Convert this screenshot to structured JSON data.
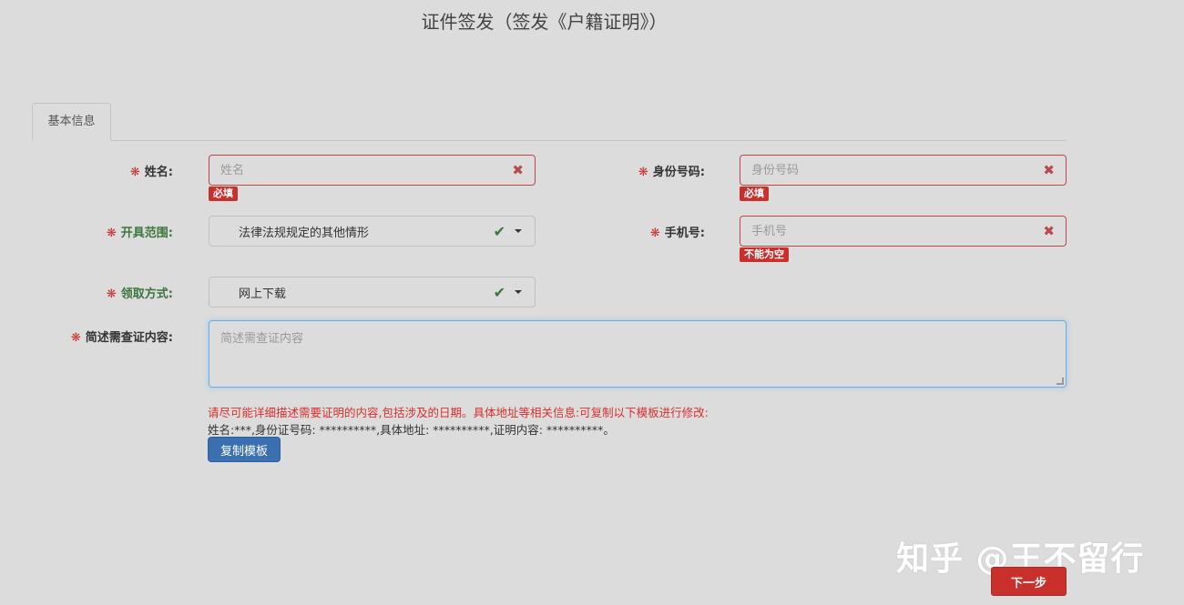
{
  "page": {
    "title": "证件签发（签发《户籍证明》）"
  },
  "tabs": [
    {
      "label": "基本信息"
    }
  ],
  "form": {
    "required_mark": "❋",
    "name": {
      "label": "姓名:",
      "placeholder": "姓名",
      "error": "必填"
    },
    "id_number": {
      "label": "身份号码:",
      "placeholder": "身份号码",
      "error": "必填"
    },
    "scope": {
      "label": "开具范围:",
      "value": "法律法规规定的其他情形"
    },
    "phone": {
      "label": "手机号:",
      "placeholder": "手机号",
      "error": "不能为空"
    },
    "pickup": {
      "label": "领取方式:",
      "value": "网上下载"
    },
    "description": {
      "label": "简述需查证内容:",
      "placeholder": "简述需查证内容"
    }
  },
  "hints": {
    "instruction": "请尽可能详细描述需要证明的内容,包括涉及的日期。具体地址等相关信息:可复制以下模板进行修改:",
    "template": "姓名:***,身份证号码: **********,具体地址: **********,证明内容: **********。"
  },
  "buttons": {
    "copy_template": "复制模板",
    "next": "下一步"
  },
  "watermark": "知乎 @王不留行",
  "colors": {
    "error": "#c9302c",
    "valid": "#3c763d",
    "primary": "#3a6fb0",
    "focus": "#66afe9"
  }
}
